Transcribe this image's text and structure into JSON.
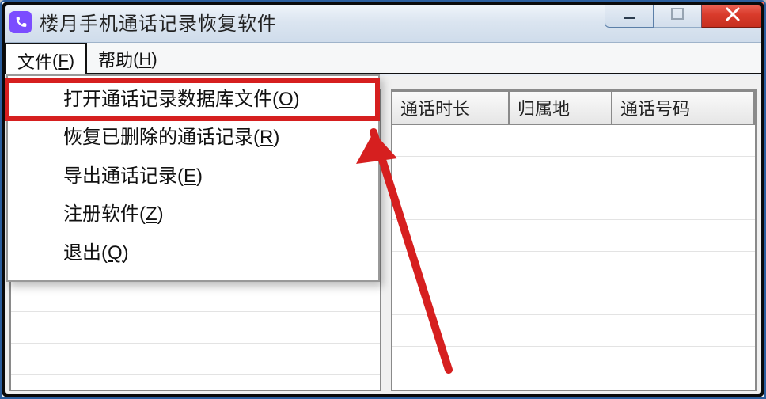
{
  "title": "楼月手机通话记录恢复软件",
  "menu": {
    "file": {
      "label": "文件",
      "accel": "F"
    },
    "help": {
      "label": "帮助",
      "accel": "H"
    }
  },
  "dropdown": {
    "items": [
      {
        "label": "打开通话记录数据库文件",
        "accel": "O"
      },
      {
        "label": "恢复已删除的通话记录",
        "accel": "R"
      },
      {
        "label": "导出通话记录",
        "accel": "E"
      },
      {
        "label": "注册软件",
        "accel": "Z"
      },
      {
        "label": "退出",
        "accel": "Q"
      }
    ]
  },
  "right_cols": [
    "通话时长",
    "归属地",
    "通话号码"
  ],
  "icon_names": {
    "app": "phone-icon",
    "min": "window-minimize-icon",
    "max": "window-maximize-icon",
    "close": "window-close-icon"
  }
}
